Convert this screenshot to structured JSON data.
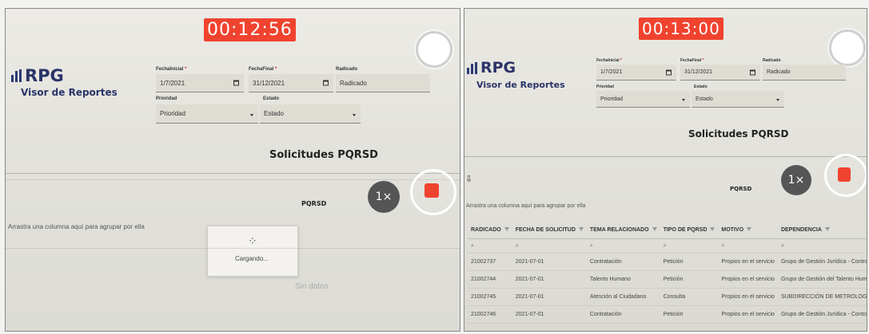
{
  "left": {
    "timer": "00:12:56",
    "logo": {
      "brand": "RPG",
      "subtitle": "Visor de Reportes"
    },
    "filters": {
      "fecha_inicial_label": "FechaInicial",
      "fecha_inicial_value": "1/7/2021",
      "fecha_final_label": "FechaFinal",
      "fecha_final_value": "31/12/2021",
      "radicado_label": "Radicado",
      "radicado_placeholder": "Radicado",
      "prioridad_label": "Prioridad",
      "prioridad_value": "Prioridad",
      "estado_label": "Estado",
      "estado_value": "Estado",
      "required_mark": "*"
    },
    "section_title": "Solicitudes PQRSD",
    "grid_title": "PQRSD",
    "group_hint": "Arrastra una columna aquí para agrupar por ella",
    "loading_text": "Cargando...",
    "no_data": "Sin datos",
    "speed": "1×"
  },
  "right": {
    "timer": "00:13:00",
    "logo": {
      "brand": "RPG",
      "subtitle": "Visor de Reportes"
    },
    "filters": {
      "fecha_inicial_label": "FechaInicial",
      "fecha_inicial_value": "1/7/2021",
      "fecha_final_label": "FechaFinal",
      "fecha_final_value": "31/12/2021",
      "radicado_label": "Radicado",
      "radicado_placeholder": "Radicado",
      "prioridad_label": "Prioridad",
      "prioridad_value": "Prioridad",
      "estado_label": "Estado",
      "estado_value": "Estado",
      "required_mark": "*"
    },
    "section_title": "Solicitudes PQRSD",
    "grid_title": "PQRSD",
    "group_hint": "Arrastra una columna aquí para agrupar por ella",
    "speed": "1×",
    "table": {
      "columns": [
        "RADICADO",
        "FECHA DE SOLICITUD",
        "TEMA RELACIONADO",
        "TIPO DE PQRSD",
        "MOTIVO",
        "DEPENDENCIA"
      ],
      "rows": [
        [
          "21002737",
          "2021-07-01",
          "Contratación",
          "Petición",
          "Propios en el servicio",
          "Grupo de Gestión Jurídica - Contratación"
        ],
        [
          "21002744",
          "2021-07-01",
          "Talento Humano",
          "Petición",
          "Propios en el servicio",
          "Grupo de Gestión del Talento Humano"
        ],
        [
          "21002745",
          "2021-07-01",
          "Atención al Ciudadano",
          "Consulta",
          "Propios en el servicio",
          "SUBDIRECCIÓN DE METROLOGÍA FÍSICA"
        ],
        [
          "21002746",
          "2021-07-01",
          "Contratación",
          "Petición",
          "Propios en el servicio",
          "Grupo de Gestión Jurídica - Contratación"
        ]
      ]
    }
  }
}
